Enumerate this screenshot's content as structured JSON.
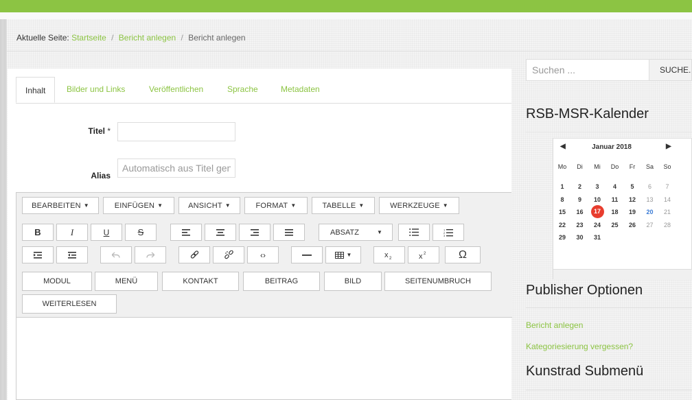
{
  "breadcrumb": {
    "prefix": "Aktuelle Seite:",
    "items": [
      "Startseite",
      "Bericht anlegen"
    ],
    "current": "Bericht anlegen",
    "separator": "/"
  },
  "tabs": [
    {
      "label": "Inhalt",
      "active": true
    },
    {
      "label": "Bilder und Links",
      "active": false
    },
    {
      "label": "Veröffentlichen",
      "active": false
    },
    {
      "label": "Sprache",
      "active": false
    },
    {
      "label": "Metadaten",
      "active": false
    }
  ],
  "form": {
    "title_label": "Titel",
    "required_mark": "*",
    "title_value": "",
    "alias_label": "Alias",
    "alias_placeholder": "Automatisch aus Titel generieren"
  },
  "editor": {
    "menus": [
      "BEARBEITEN",
      "EINFÜGEN",
      "ANSICHT",
      "FORMAT",
      "TABELLE",
      "WERKZEUGE"
    ],
    "format_select": "ABSATZ",
    "buttons": [
      "MODUL",
      "MENÜ",
      "KONTAKT",
      "BEITRAG",
      "BILD",
      "SEITENUMBRUCH",
      "WEITERLESEN"
    ],
    "icons": {
      "row1": [
        "bold-icon",
        "italic-icon",
        "underline-icon",
        "strikethrough-icon",
        "align-left-icon",
        "align-center-icon",
        "align-right-icon",
        "align-justify-icon",
        "bullet-list-icon",
        "numbered-list-icon"
      ],
      "row2": [
        "outdent-icon",
        "indent-icon",
        "undo-icon",
        "redo-icon",
        "link-icon",
        "unlink-icon",
        "code-icon",
        "horizontal-rule-icon",
        "table-icon",
        "subscript-icon",
        "superscript-icon",
        "omega-icon"
      ]
    },
    "bold_glyph": "B",
    "italic_glyph": "I",
    "underline_glyph": "U",
    "strike_glyph": "S",
    "omega_glyph": "Ω",
    "code_glyph": "‹›"
  },
  "sidebar": {
    "search_placeholder": "Suchen ...",
    "search_button": "SUCHE...",
    "calendar_title": "RSB-MSR-Kalender",
    "calendar": {
      "month": "Januar 2018",
      "weekdays": [
        "Mo",
        "Di",
        "Mi",
        "Do",
        "Fr",
        "Sa",
        "So"
      ],
      "weeks": [
        [
          "1",
          "2",
          "3",
          "4",
          "5",
          "6",
          "7"
        ],
        [
          "8",
          "9",
          "10",
          "11",
          "12",
          "13",
          "14"
        ],
        [
          "15",
          "16",
          "17",
          "18",
          "19",
          "20",
          "21"
        ],
        [
          "22",
          "23",
          "24",
          "25",
          "26",
          "27",
          "28"
        ],
        [
          "29",
          "30",
          "31",
          "",
          "",
          "",
          ""
        ]
      ],
      "today": "17",
      "highlight": "20",
      "prev_glyph": "◀",
      "next_glyph": "▶"
    },
    "publisher_title": "Publisher Optionen",
    "links": [
      "Bericht anlegen",
      "Kategoriesierung vergessen?"
    ],
    "submenu_title": "Kunstrad Submenü"
  },
  "colors": {
    "accent": "#8cc443",
    "today": "#e83d2e",
    "highlight": "#3a7bd5"
  }
}
